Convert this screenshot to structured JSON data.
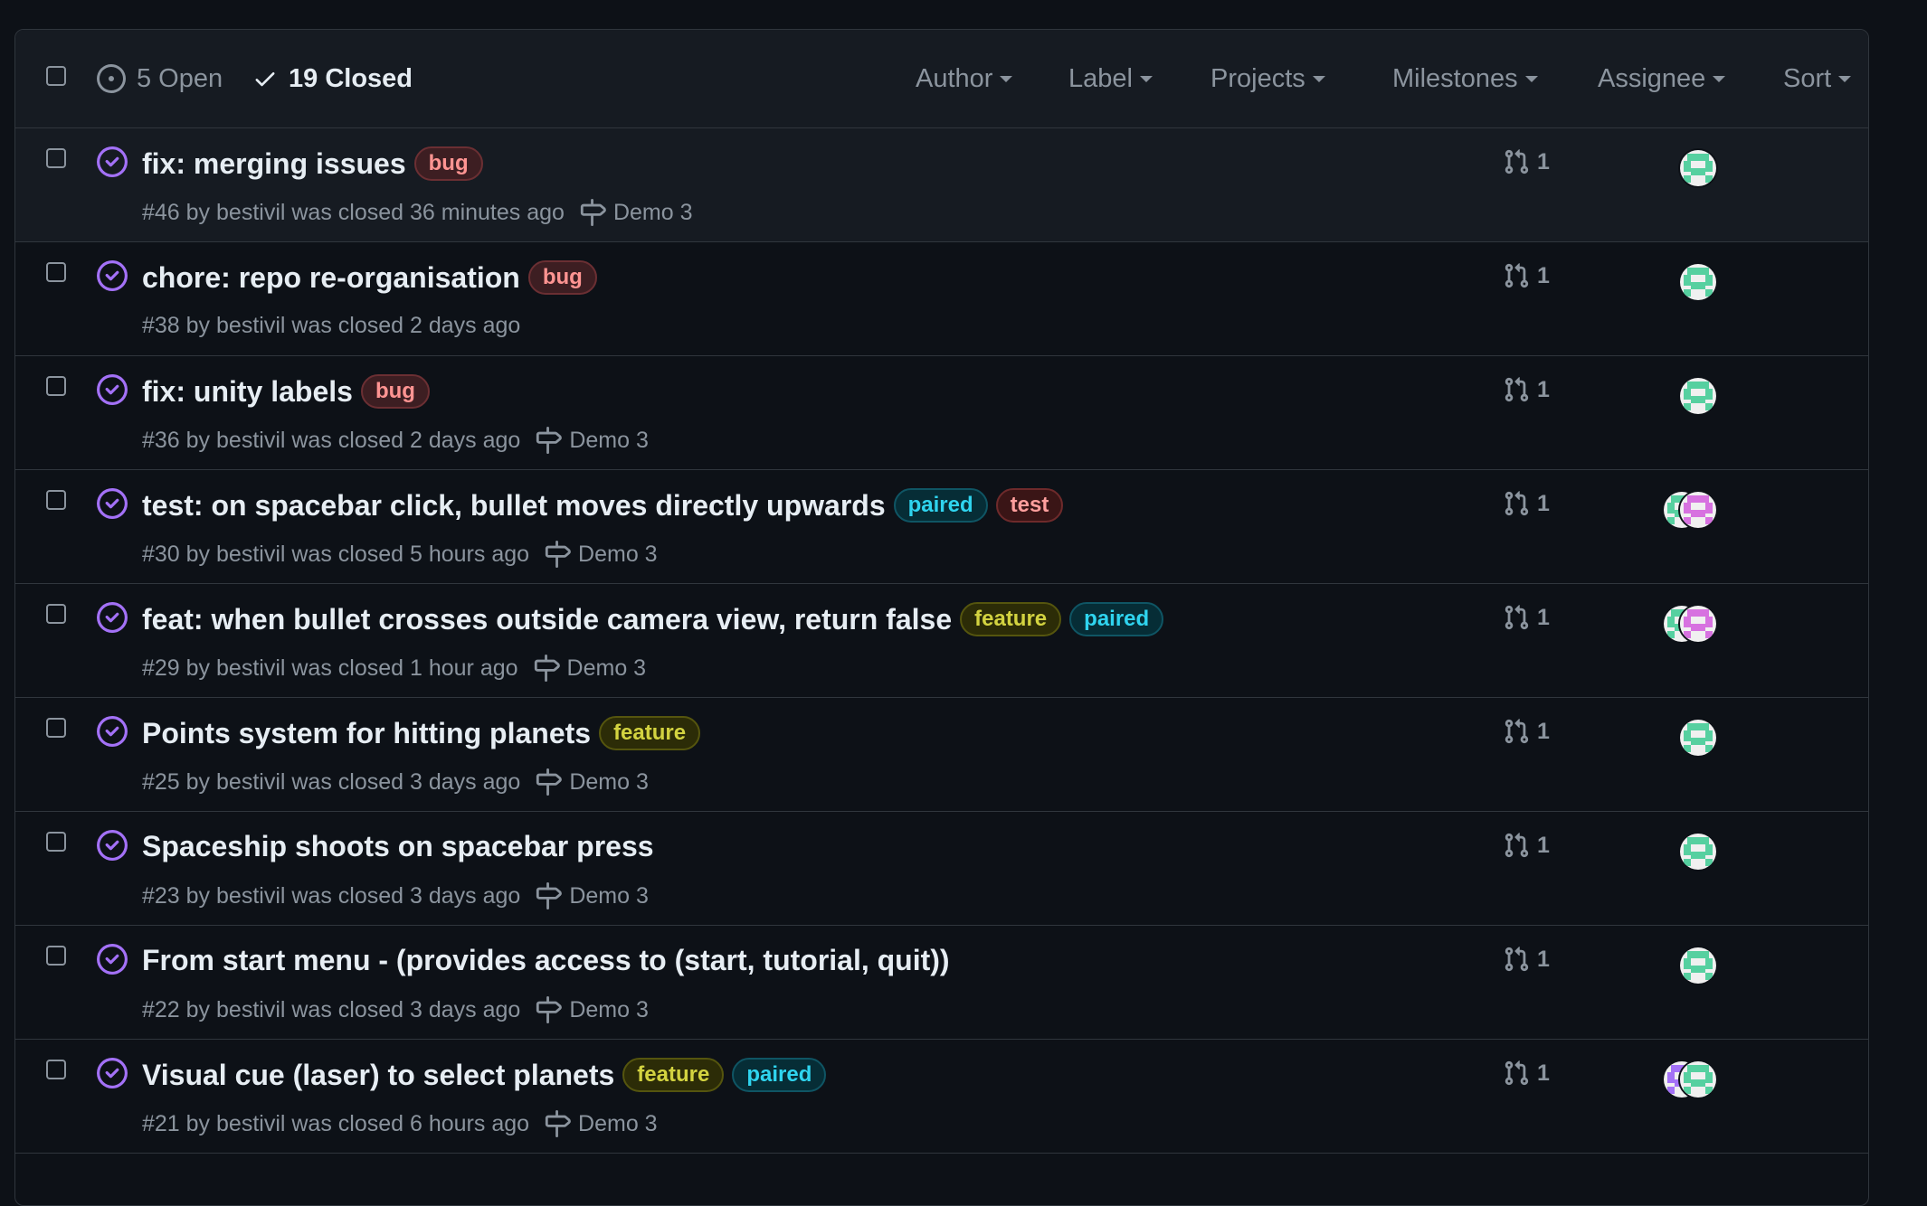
{
  "header": {
    "open_count": "5 Open",
    "closed_count": "19 Closed",
    "filters": [
      "Author",
      "Label",
      "Projects",
      "Milestones",
      "Assignee",
      "Sort"
    ]
  },
  "colors": {
    "closed_icon": "#a371f7",
    "avatar_green": "#56d0a0",
    "avatar_pink": "#d772e0",
    "avatar_purple": "#a371f7"
  },
  "issues": [
    {
      "title": "fix: merging issues",
      "labels": [
        {
          "text": "bug",
          "kind": "bug"
        }
      ],
      "meta": "#46 by bestivil was closed 36 minutes ago",
      "milestone": "Demo 3",
      "pr_count": "1",
      "avatars": [
        "green"
      ]
    },
    {
      "title": "chore: repo re-organisation",
      "labels": [
        {
          "text": "bug",
          "kind": "bug"
        }
      ],
      "meta": "#38 by bestivil was closed 2 days ago",
      "milestone": "",
      "pr_count": "1",
      "avatars": [
        "green"
      ]
    },
    {
      "title": "fix: unity labels",
      "labels": [
        {
          "text": "bug",
          "kind": "bug"
        }
      ],
      "meta": "#36 by bestivil was closed 2 days ago",
      "milestone": "Demo 3",
      "pr_count": "1",
      "avatars": [
        "green"
      ]
    },
    {
      "title": "test: on spacebar click, bullet moves directly upwards",
      "labels": [
        {
          "text": "paired",
          "kind": "paired"
        },
        {
          "text": "test",
          "kind": "test"
        }
      ],
      "meta": "#30 by bestivil was closed 5 hours ago",
      "milestone": "Demo 3",
      "pr_count": "1",
      "avatars": [
        "green",
        "pink"
      ]
    },
    {
      "title": "feat: when bullet crosses outside camera view, return false",
      "labels": [
        {
          "text": "feature",
          "kind": "feature"
        },
        {
          "text": "paired",
          "kind": "paired"
        }
      ],
      "meta": "#29 by bestivil was closed 1 hour ago",
      "milestone": "Demo 3",
      "pr_count": "1",
      "avatars": [
        "green",
        "pink"
      ]
    },
    {
      "title": "Points system for hitting planets",
      "labels": [
        {
          "text": "feature",
          "kind": "feature"
        }
      ],
      "meta": "#25 by bestivil was closed 3 days ago",
      "milestone": "Demo 3",
      "pr_count": "1",
      "avatars": [
        "green"
      ]
    },
    {
      "title": "Spaceship shoots on spacebar press",
      "labels": [],
      "meta": "#23 by bestivil was closed 3 days ago",
      "milestone": "Demo 3",
      "pr_count": "1",
      "avatars": [
        "green"
      ]
    },
    {
      "title": "From start menu - (provides access to (start, tutorial, quit))",
      "labels": [],
      "meta": "#22 by bestivil was closed 3 days ago",
      "milestone": "Demo 3",
      "pr_count": "1",
      "avatars": [
        "green"
      ]
    },
    {
      "title": "Visual cue (laser) to select planets",
      "labels": [
        {
          "text": "feature",
          "kind": "feature"
        },
        {
          "text": "paired",
          "kind": "paired"
        }
      ],
      "meta": "#21 by bestivil was closed 6 hours ago",
      "milestone": "Demo 3",
      "pr_count": "1",
      "avatars": [
        "purple",
        "green"
      ]
    }
  ]
}
